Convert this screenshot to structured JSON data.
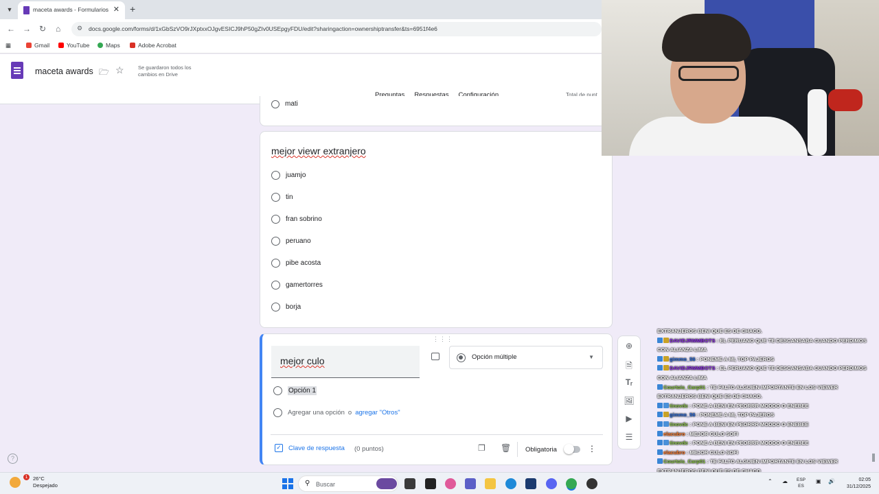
{
  "browser": {
    "tab_title": "maceta awards - Formularios d",
    "url": "docs.google.com/forms/d/1xGbSzVO9rJXptxxOJgvESICJ9hP50gZIv0USEpgyFDU/edit?sharingaction=ownershiptransfer&ts=6951f4e6",
    "bookmarks": [
      "Gmail",
      "YouTube",
      "Maps",
      "Adobe Acrobat"
    ]
  },
  "forms_header": {
    "title": "maceta awards",
    "saved_status": "Se guardaron todos los cambios en Drive",
    "tabs": [
      "Preguntas",
      "Respuestas",
      "Configuración"
    ],
    "active_tab": "Preguntas",
    "total_points": "Total de punt"
  },
  "previous_question": {
    "partial_option": "mati"
  },
  "question1": {
    "title": "mejor viewr extranjero",
    "options": [
      "juamjo",
      "tin",
      "fran sobrino",
      "peruano",
      "pibe acosta",
      "gamertorres",
      "borja"
    ]
  },
  "question2": {
    "title": "mejor culo",
    "type": "Opción múltiple",
    "option1": "Opción 1",
    "add_option": "Agregar una opción",
    "or_label": "o",
    "add_other": "agregar \"Otros\"",
    "answer_key": "Clave de respuesta",
    "points": "(0 puntos)",
    "required": "Obligatoria",
    "required_on": false
  },
  "sidebar_icons": [
    "add-question-icon",
    "import-questions-icon",
    "title-text-icon",
    "image-icon",
    "video-icon",
    "section-icon"
  ],
  "chat": [
    {
      "user": "",
      "badge": "",
      "text": "EXTRANJEROS BENI QUE ES DE CHACO."
    },
    {
      "user": "DAVIDJRMMBOTS",
      "badge": "#c9a227",
      "text": "EL PERUANO QUE TE DESCANSABA CUANDO PERDIMOS CON ALIANZA LIMA"
    },
    {
      "user": "gimmo_56",
      "badge": "#c9a227",
      "text": "PONEME A MI, TOP PAJEROS"
    },
    {
      "user": "DAVIDJRMMBOTS",
      "badge": "#c9a227",
      "text": "EL PERUANO QUE TE DESCANSABA CUANDO PERDIMOS CON ALIANZA LIMA"
    },
    {
      "user": "Courtois_Carp01",
      "badge": "",
      "text": "TE FALTO ALGUIEN IMPORTANTE EN LOS VIEWER EXTRANJEROS BENI QUE ES DE CHACO."
    },
    {
      "user": "tinovdc",
      "badge": "#4a90d9",
      "text": "PONE A BENI EN PEORRR MODDO O ENEBEE"
    },
    {
      "user": "gimmo_56",
      "badge": "#c9a227",
      "text": "PONEME A MI, TOP PAJEROS"
    },
    {
      "user": "tinovdc",
      "badge": "#4a90d9",
      "text": "PONE A BENI EN PEORRR MODDO O ENEBEE"
    },
    {
      "user": "elacubro",
      "badge": "",
      "text": "MEJOR CULO SOFI"
    },
    {
      "user": "tinovdc",
      "badge": "#4a90d9",
      "text": "PONE A BENI EN PEORRR MODDO O ENEBEE"
    },
    {
      "user": "elacubro",
      "badge": "",
      "text": "MEJOR CULO SOFI"
    },
    {
      "user": "Courtois_Carp01",
      "badge": "",
      "text": "TE FALTO ALGUIEN IMPORTANTE EN LOS VIEWER EXTRANJEROS BENI QUE ES DE CHACO"
    }
  ],
  "chat_user_colors": {
    "DAVIDJRMMBOTS": "#8a2be2",
    "gimmo_56": "#2f6fdf",
    "Courtois_Carp01": "#8bc34a",
    "tinovdc": "#8bc34a",
    "elacubro": "#ff7b2b"
  },
  "taskbar": {
    "weather_temp": "26°C",
    "weather_desc": "Despejado",
    "weather_badge": "1",
    "search_placeholder": "Buscar",
    "lang_top": "ESP",
    "lang_bottom": "ES",
    "time": "02:05",
    "date": "31/12/2025"
  },
  "colors": {
    "forms_purple": "#673ab7",
    "active_blue": "#4285f4",
    "link_blue": "#1a73e8"
  }
}
